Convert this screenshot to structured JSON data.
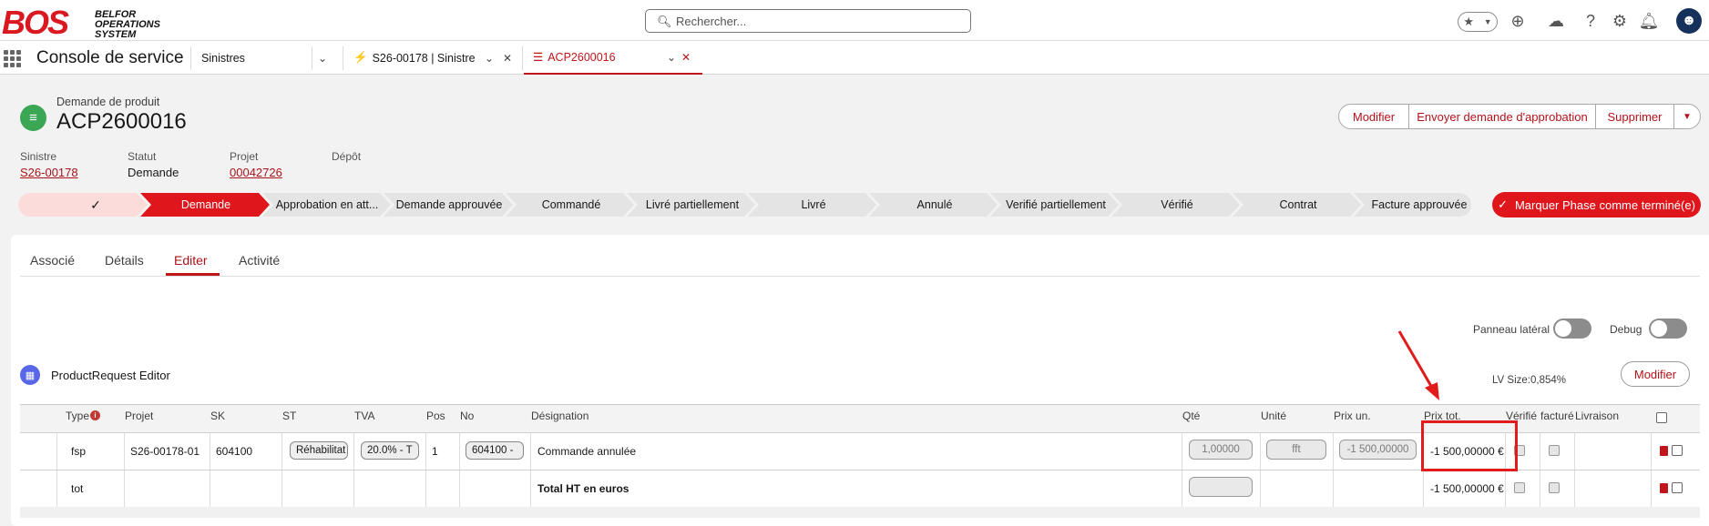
{
  "header": {
    "logo_text": "BOS",
    "logo_tagline": "BELFOR OPERATIONS SYSTEM",
    "search_placeholder": "Rechercher...",
    "icons": [
      "favorites-icon",
      "add-icon",
      "trailhead-icon",
      "help-icon",
      "settings-icon",
      "notifications-icon",
      "avatar-icon"
    ]
  },
  "nav": {
    "app_name": "Console de service",
    "object_select": "Sinistres",
    "tabs": [
      {
        "label": "S26-00178 | Sinistre",
        "icon": "case-icon"
      },
      {
        "label": "ACP2600016",
        "icon": "product-request-icon",
        "active": true
      }
    ]
  },
  "record": {
    "type": "Demande de produit",
    "name": "ACP2600016",
    "fields": [
      {
        "label": "Sinistre",
        "value": "S26-00178",
        "link": true
      },
      {
        "label": "Statut",
        "value": "Demande",
        "link": false
      },
      {
        "label": "Projet",
        "value": "00042726",
        "link": true
      },
      {
        "label": "Dépôt",
        "value": "",
        "link": false
      }
    ],
    "actions": [
      "Modifier",
      "Envoyer demande d'approbation",
      "Supprimer"
    ]
  },
  "path": {
    "completed_mark": "✓",
    "steps": [
      "",
      "Demande",
      "Approbation en att...",
      "Demande approuvée",
      "Commandé",
      "Livré partiellement",
      "Livré",
      "Annulé",
      "Verifié partiellement",
      "Vérifié",
      "Contrat",
      "Facture approuvée"
    ],
    "current_index": 1,
    "mark_button": "Marquer Phase comme terminé(e)"
  },
  "subtabs": {
    "items": [
      "Associé",
      "Détails",
      "Editer",
      "Activité"
    ],
    "active": "Editer"
  },
  "editor": {
    "toggle_side_panel": "Panneau latéral",
    "toggle_debug": "Debug",
    "title": "ProductRequest Editor",
    "lv_size": "LV Size:0,854%",
    "modify_button": "Modifier",
    "columns": [
      "Type",
      "Projet",
      "SK",
      "ST",
      "TVA",
      "Pos",
      "No",
      "Désignation",
      "Qté",
      "Unité",
      "Prix un.",
      "Prix tot.",
      "Vérifié",
      "facturé",
      "Livraison"
    ],
    "rows": [
      {
        "type": "fsp",
        "projet": "S26-00178-01",
        "sk": "604100",
        "st": "Réhabilitat",
        "tva": "20.0% - T",
        "pos": "1",
        "no": "604100 -",
        "designation": "Commande annulée",
        "qte": "1,00000",
        "unite": "fft",
        "prix_un": "-1 500,00000",
        "prix_tot": "-1 500,00000 €"
      },
      {
        "type": "tot",
        "projet": "",
        "sk": "",
        "st": "",
        "tva": "",
        "pos": "",
        "no": "",
        "designation": "Total HT en euros",
        "qte": "",
        "unite": "",
        "prix_un": "",
        "prix_tot": "-1 500,00000 €"
      }
    ]
  },
  "colors": {
    "brand_red": "#d9181f",
    "accent_red": "#c0151b",
    "path_current": "#e0161d"
  }
}
